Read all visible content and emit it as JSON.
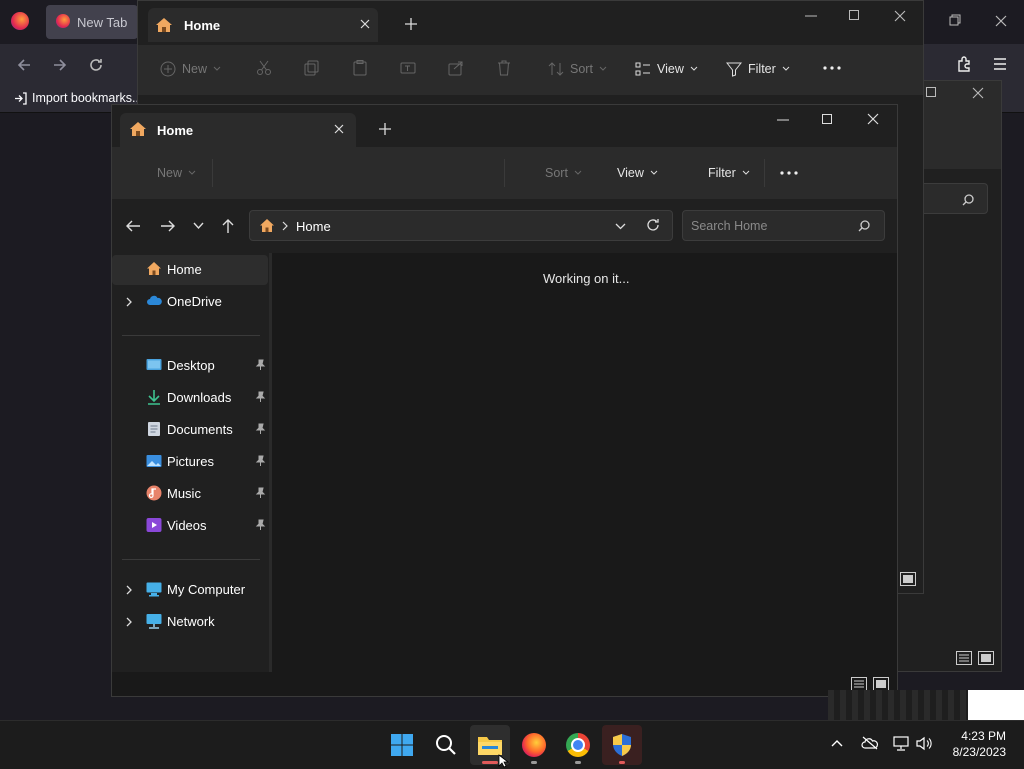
{
  "firefox": {
    "tab_label": "New Tab",
    "import_bookmarks": "Import bookmarks..."
  },
  "back_explorer": {
    "tab_label": "Home",
    "toolbar": {
      "new_label": "New",
      "sort_label": "Sort",
      "view_label": "View",
      "filter_label": "Filter"
    }
  },
  "explorer": {
    "tab_label": "Home",
    "toolbar": {
      "new_label": "New",
      "sort_label": "Sort",
      "view_label": "View",
      "filter_label": "Filter"
    },
    "address": {
      "location": "Home"
    },
    "search": {
      "placeholder": "Search Home"
    },
    "nav": {
      "home": "Home",
      "onedrive": "OneDrive",
      "desktop": "Desktop",
      "downloads": "Downloads",
      "documents": "Documents",
      "pictures": "Pictures",
      "music": "Music",
      "videos": "Videos",
      "my_computer": "My Computer",
      "network": "Network"
    },
    "status": "Working on it..."
  },
  "taskbar": {
    "time": "4:23 PM",
    "date": "8/23/2023"
  },
  "colors": {
    "accent_folder": "#f7c948",
    "home_icon": "#f0a860",
    "running_indicator": "#e05a5a"
  }
}
